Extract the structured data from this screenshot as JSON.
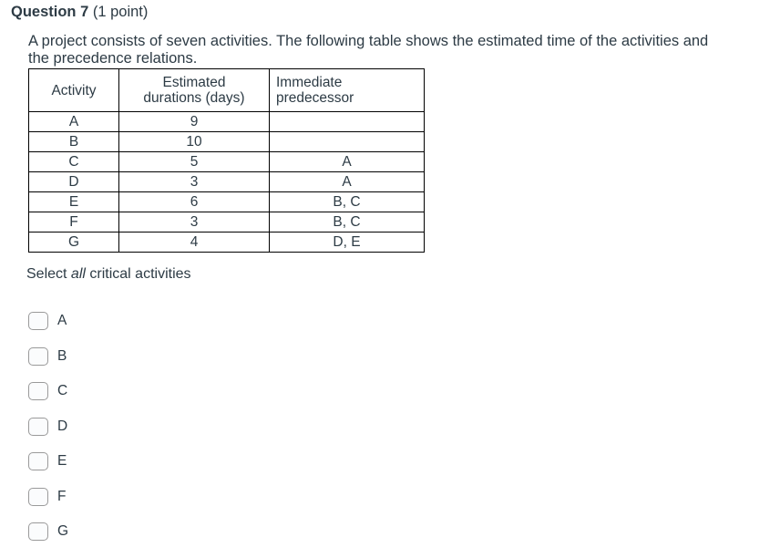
{
  "header": {
    "title": "Question 7",
    "points": "(1 point)"
  },
  "body": {
    "text": "A project consists of seven activities. The following table shows the estimated time of the activities and the precedence relations."
  },
  "table": {
    "columns": [
      "Activity",
      "Estimated durations (days)",
      "Immediate predecessor"
    ],
    "column_header_lines": {
      "activity": "Activity",
      "duration_line1": "Estimated",
      "duration_line2": "durations (days)",
      "predecessor_line1": "Immediate",
      "predecessor_line2": "predecessor"
    },
    "rows": [
      {
        "activity": "A",
        "duration": "9",
        "predecessor": ""
      },
      {
        "activity": "B",
        "duration": "10",
        "predecessor": ""
      },
      {
        "activity": "C",
        "duration": "5",
        "predecessor": "A"
      },
      {
        "activity": "D",
        "duration": "3",
        "predecessor": "A"
      },
      {
        "activity": "E",
        "duration": "6",
        "predecessor": "B, C"
      },
      {
        "activity": "F",
        "duration": "3",
        "predecessor": "B, C"
      },
      {
        "activity": "G",
        "duration": "4",
        "predecessor": "D, E"
      }
    ]
  },
  "prompt": {
    "before": "Select ",
    "emphasis": "all",
    "after": " critical activities"
  },
  "answers": {
    "options": [
      {
        "label": "A",
        "checked": false
      },
      {
        "label": "B",
        "checked": false
      },
      {
        "label": "C",
        "checked": false
      },
      {
        "label": "D",
        "checked": false
      },
      {
        "label": "E",
        "checked": false
      },
      {
        "label": "F",
        "checked": false
      },
      {
        "label": "G",
        "checked": false
      }
    ]
  },
  "colors": {
    "text": "#2d3b45",
    "table_border": "#000000",
    "checkbox_border": "#9a9a9a",
    "checkbox_fill": "#fbfcfd",
    "page_background": "#ffffff"
  }
}
